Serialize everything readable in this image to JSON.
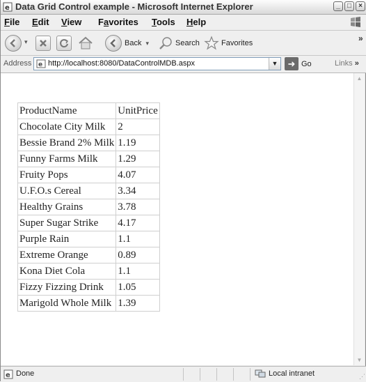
{
  "window": {
    "title": "Data Grid Control example - Microsoft Internet Explorer",
    "controls": [
      "minimize",
      "maximize",
      "close"
    ]
  },
  "menubar": {
    "items": [
      {
        "label": "File",
        "accel": "F",
        "rest": "ile"
      },
      {
        "label": "Edit",
        "accel": "E",
        "rest": "dit"
      },
      {
        "label": "View",
        "accel": "V",
        "rest": "iew"
      },
      {
        "label": "Favorites",
        "accel": "a",
        "pre": "F",
        "rest": "vorites"
      },
      {
        "label": "Tools",
        "accel": "T",
        "rest": "ools"
      },
      {
        "label": "Help",
        "accel": "H",
        "rest": "elp"
      }
    ]
  },
  "toolbar": {
    "back_label": "Back",
    "search_label": "Search",
    "favorites_label": "Favorites",
    "chevron": "»"
  },
  "addressbar": {
    "label": "Address",
    "url": "http://localhost:8080/DataControlMDB.aspx",
    "go_label": "Go",
    "links_label": "Links",
    "chevron": "»"
  },
  "grid": {
    "columns": [
      "ProductName",
      "UnitPrice"
    ],
    "rows": [
      [
        "Chocolate City Milk",
        "2"
      ],
      [
        "Bessie Brand 2% Milk",
        "1.19"
      ],
      [
        "Funny Farms Milk",
        "1.29"
      ],
      [
        "Fruity Pops",
        "4.07"
      ],
      [
        "U.F.O.s Cereal",
        "3.34"
      ],
      [
        "Healthy Grains",
        "3.78"
      ],
      [
        "Super Sugar Strike",
        "4.17"
      ],
      [
        "Purple Rain",
        "1.1"
      ],
      [
        "Extreme Orange",
        "0.89"
      ],
      [
        "Kona Diet Cola",
        "1.1"
      ],
      [
        "Fizzy Fizzing Drink",
        "1.05"
      ],
      [
        "Marigold Whole Milk",
        "1.39"
      ]
    ]
  },
  "statusbar": {
    "status": "Done",
    "zone": "Local intranet"
  }
}
